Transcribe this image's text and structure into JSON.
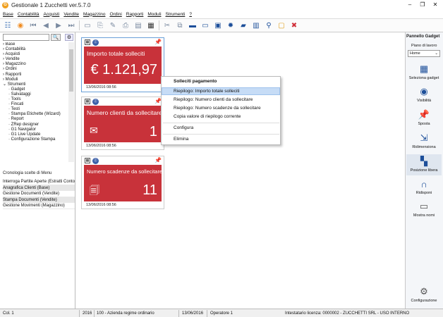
{
  "window": {
    "title": "Gestionale 1 Zucchetti ver.5.7.0",
    "logo_letter": "G",
    "controls": [
      "–",
      "❐",
      "✕"
    ]
  },
  "menubar": {
    "items": [
      "Base",
      "Contabilità",
      "Acquisti",
      "Vendite",
      "Magazzino",
      "Ordini",
      "Rapporti",
      "Moduli",
      "Strumenti",
      "?"
    ]
  },
  "toolbar": {
    "icons": [
      "menu-tree-icon",
      "rss-icon",
      "first-icon",
      "prev-icon",
      "next-icon",
      "last-icon",
      "new-doc-icon",
      "preview-icon",
      "edit-icon",
      "print-icon",
      "page-icon",
      "calculator-icon",
      "cut-icon",
      "copy-icon",
      "window-icon",
      "window2-icon",
      "window3-icon",
      "settings-icon",
      "briefcase-icon",
      "chart-icon",
      "clip-icon",
      "folder-icon",
      "close-icon"
    ]
  },
  "leftpanel": {
    "search_btn": "🔍",
    "tree_opt": "⚙",
    "tree": [
      "Base",
      "Contabilità",
      "Acquisti",
      "Vendite",
      "Magazzino",
      "Ordini",
      "Rapporti",
      "Moduli",
      "Strumenti",
      "Gadget",
      "Salvataggi",
      "Tools",
      "Fincati",
      "Testi",
      "Stampa Etichette (Wizard)",
      "Report",
      "ZRep designer",
      "G1 Navigator",
      "G1 Live Update",
      "Configurazione Stampa"
    ],
    "history_title": "Cronologia scelte di Menu",
    "history": [
      "Interroga Partite Aperte (Estratti Conto)",
      "Anagrafica Clienti (Base)",
      "Gestione Documenti (Vendite)",
      "Stampa Documenti (Vendite)",
      "Gestione Movimenti (Magazzino)"
    ]
  },
  "gadgets": [
    {
      "title": "Importo totale solleciti",
      "value": "€  1.121,97",
      "date": "13/06/2016 08:56"
    },
    {
      "title": "Numero clienti da sollecitare",
      "value": "1",
      "icon": "✉",
      "date": "13/06/2016 08:56"
    },
    {
      "title": "Numero scadenze da sollecitare",
      "value": "11",
      "icon": "🗐",
      "date": "13/06/2016 08:56"
    }
  ],
  "context_menu": {
    "title": "Solleciti pagamento",
    "items": [
      "Riepilogo: Importo totale solleciti",
      "Riepilogo: Numero clienti da sollecitare",
      "Riepilogo: Numero scadenze da sollecitare",
      "Copia valore di riepilogo corrente",
      "Configura",
      "Elimina"
    ]
  },
  "rightpanel": {
    "title": "Pannello Gadget",
    "workspace_label": "Piano di lavoro",
    "workspace_value": "Home",
    "buttons": [
      "Seleziona gadget",
      "Visibilità",
      "Sposta",
      "Ridimensiona",
      "Posizione libera",
      "Ridisponi",
      "Mostra nomi",
      "Configurazione"
    ]
  },
  "statusbar": {
    "col": "Col. 1",
    "year": "2016",
    "company": "100 - Azienda regime ordinario",
    "date": "13/06/2016",
    "operator": "Operatore 1",
    "license": "Intestatario licenza: 0000002 - ZUCCHETTI SRL - USO INTERNO"
  }
}
